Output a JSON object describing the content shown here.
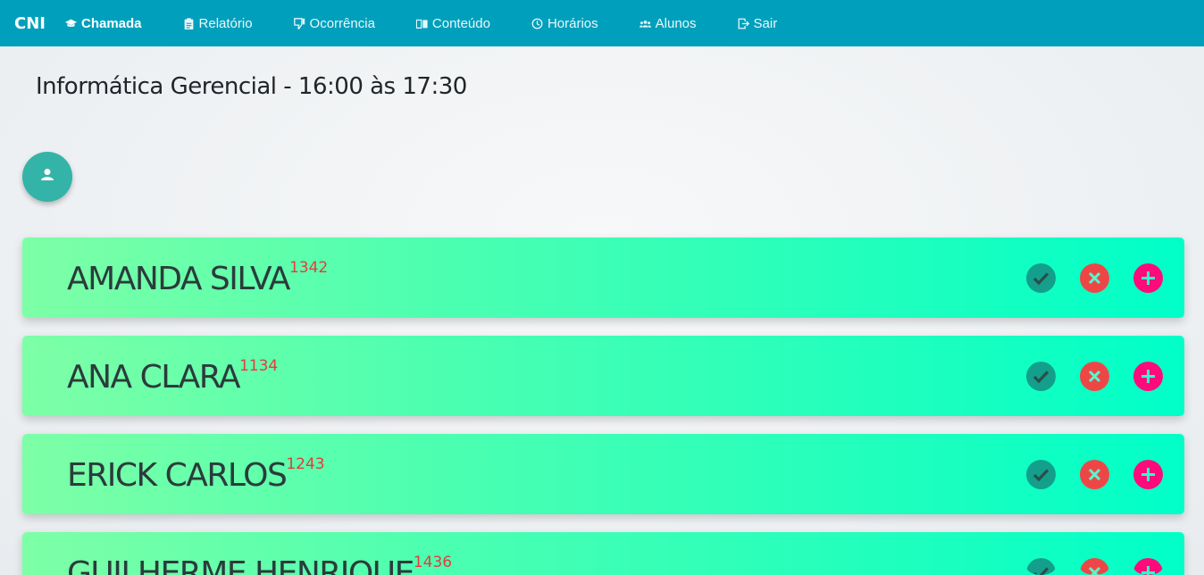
{
  "brand": "CNI",
  "nav": [
    {
      "label": "Chamada",
      "icon": "graduation-cap-icon",
      "active": true
    },
    {
      "label": "Relatório",
      "icon": "clipboard-icon",
      "active": false
    },
    {
      "label": "Ocorrência",
      "icon": "thumbs-down-icon",
      "active": false
    },
    {
      "label": "Conteúdo",
      "icon": "book-open-icon",
      "active": false
    },
    {
      "label": "Horários",
      "icon": "clock-icon",
      "active": false
    },
    {
      "label": "Alunos",
      "icon": "users-icon",
      "active": false
    },
    {
      "label": "Sair",
      "icon": "exit-icon",
      "active": false
    }
  ],
  "page_title": "Informática Gerencial - 16:00 às 17:30",
  "fab_icon": "person-icon",
  "students": [
    {
      "name": "AMANDA SILVA",
      "id": "1342"
    },
    {
      "name": "ANA CLARA",
      "id": "1134"
    },
    {
      "name": "ERICK CARLOS",
      "id": "1243"
    },
    {
      "name": "GUILHERME HENRIQUE",
      "id": "1436"
    }
  ],
  "actions": {
    "present_icon": "check-circle-icon",
    "absent_icon": "x-circle-icon",
    "add_icon": "plus-circle-icon"
  },
  "colors": {
    "navbar": "#00a0bd",
    "fab": "#34b3a8",
    "present": "#139f8c",
    "absent": "#ee4646",
    "add": "#ff0a7a",
    "student_id": "#e03e3e"
  }
}
